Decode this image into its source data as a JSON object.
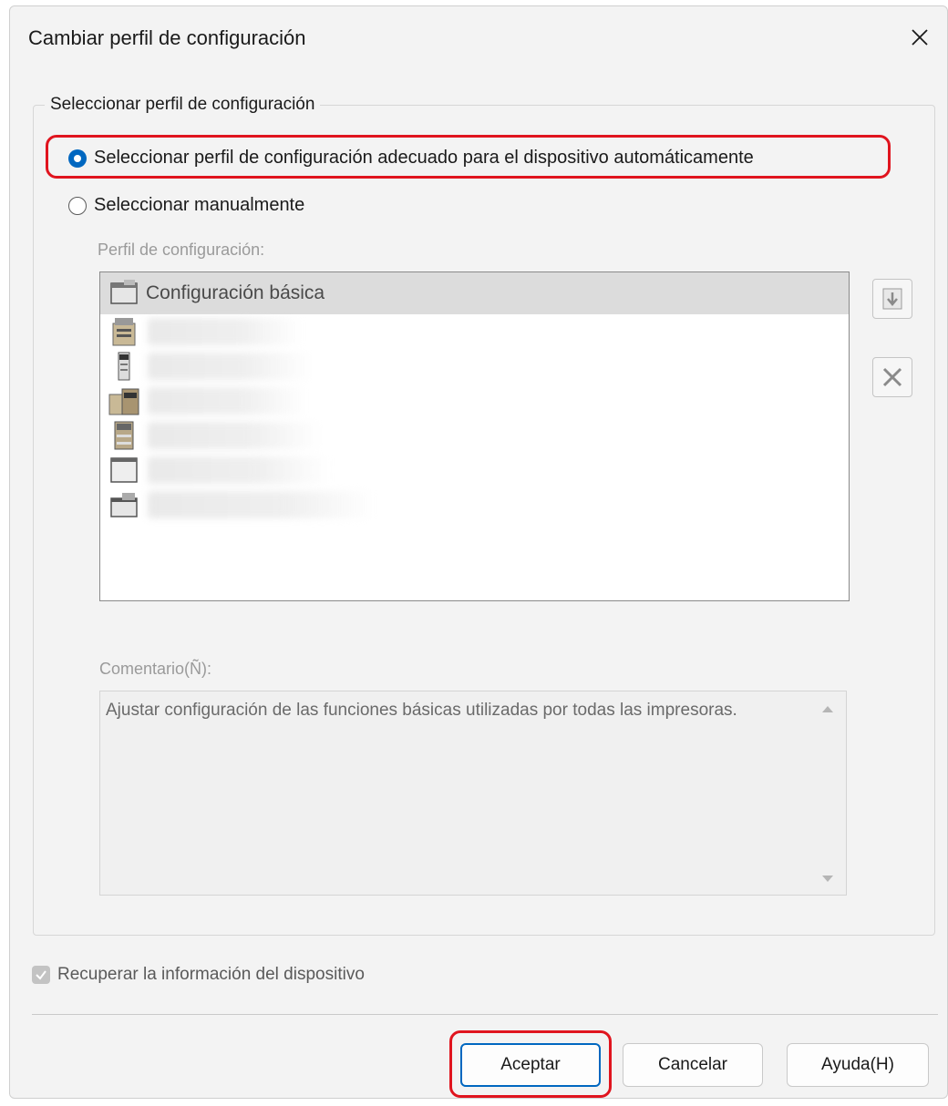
{
  "dialog": {
    "title": "Cambiar perfil de configuración",
    "close_icon": "close-icon"
  },
  "profile_group": {
    "legend": "Seleccionar perfil de configuración",
    "auto_option": "Seleccionar perfil de configuración adecuado para el dispositivo automáticamente",
    "manual_option": "Seleccionar manualmente",
    "selected": "auto",
    "profile_list_label": "Perfil de configuración:",
    "profiles": [
      {
        "label": "Configuración básica",
        "icon": "printer-basic-icon",
        "selected": true
      },
      {
        "label": "",
        "icon": "printer-large-icon"
      },
      {
        "label": "",
        "icon": "printer-small-icon"
      },
      {
        "label": "",
        "icon": "printer-office-icon"
      },
      {
        "label": "",
        "icon": "printer-tower-icon"
      },
      {
        "label": "",
        "icon": "printer-panel-icon"
      },
      {
        "label": "",
        "icon": "printer-scanner-icon"
      }
    ],
    "side_buttons": [
      "import-icon",
      "delete-icon"
    ],
    "comment_label": "Comentario(Ñ):",
    "comment_text": "Ajustar configuración de las funciones básicas utilizadas por todas las impresoras."
  },
  "retrieve_info": {
    "label": "Recuperar la información del dispositivo",
    "checked": true
  },
  "buttons": {
    "ok": "Aceptar",
    "cancel": "Cancelar",
    "help": "Ayuda(H)"
  },
  "accent_color": "#0067c0",
  "highlight_color": "#e0141e"
}
